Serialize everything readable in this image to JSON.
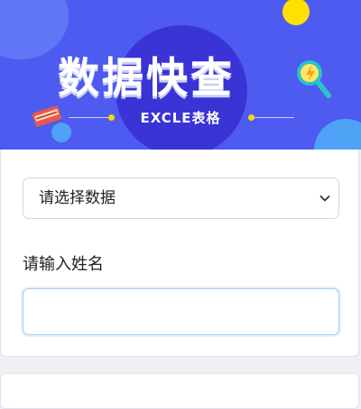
{
  "banner": {
    "title": "数据快查",
    "subtitle": "EXCLE表格",
    "colors": {
      "background": "#4d5bf0",
      "accent_yellow": "#ffe100",
      "accent_blue": "#4ea3f7"
    },
    "icons": [
      "magnifier-icon",
      "book-icon"
    ]
  },
  "form": {
    "select": {
      "selected_label": "请选择数据",
      "icon": "chevron-down-icon"
    },
    "name_label": "请输入姓名",
    "name_input": {
      "value": "",
      "placeholder": ""
    }
  }
}
